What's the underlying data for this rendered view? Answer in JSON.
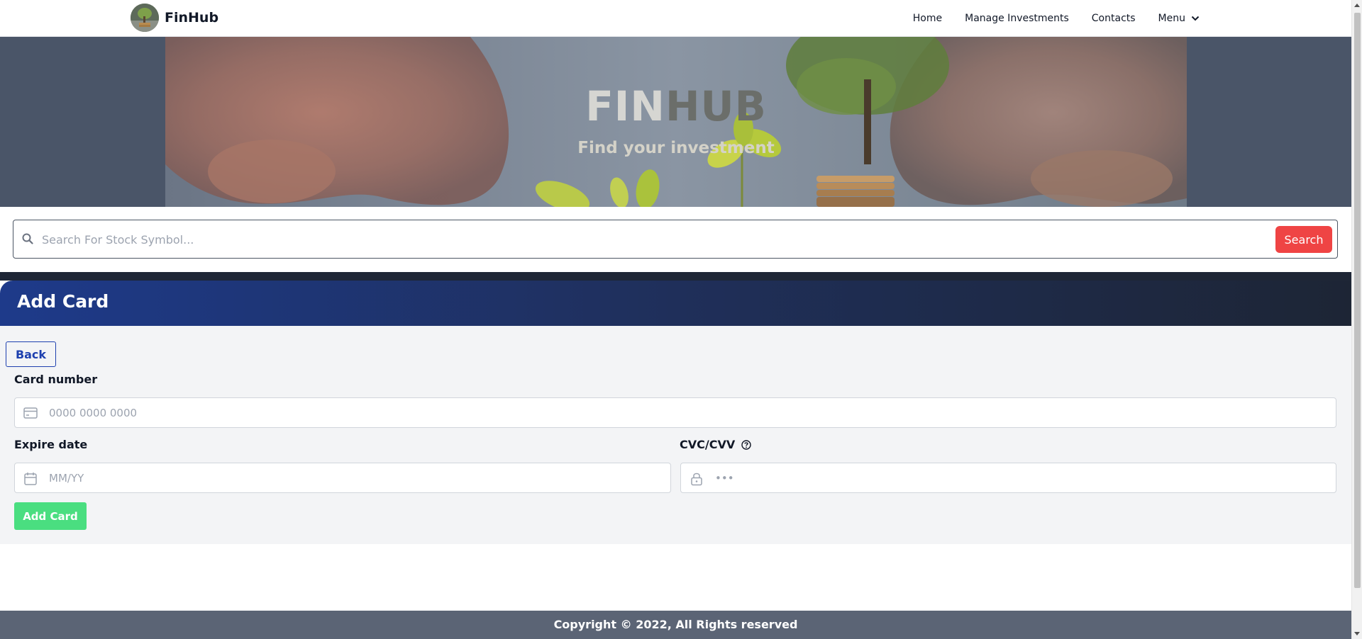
{
  "navbar": {
    "brand": "FinHub",
    "links": [
      {
        "label": "Home"
      },
      {
        "label": "Manage Investments"
      },
      {
        "label": "Contacts"
      },
      {
        "label": "Menu"
      }
    ]
  },
  "hero": {
    "title_part1": "FIN",
    "title_part2": "HUB",
    "subtitle": "Find your investment"
  },
  "search": {
    "placeholder": "Search For Stock Symbol...",
    "button_label": "Search"
  },
  "card_header": {
    "title": "Add Card"
  },
  "form": {
    "back_label": "Back",
    "card_number_label": "Card number",
    "card_number_placeholder": "0000 0000 0000",
    "expire_label": "Expire date",
    "expire_placeholder": "MM/YY",
    "cvc_label": "CVC/CVV",
    "cvc_placeholder": "•••",
    "submit_label": "Add Card"
  },
  "footer": {
    "text": "Copyright © 2022, All Rights reserved"
  },
  "icons": {
    "logo": "finhub-logo-icon",
    "chevron": "chevron-down-icon",
    "search": "search-icon",
    "card": "credit-card-icon",
    "calendar": "calendar-icon",
    "lock": "lock-icon",
    "help": "help-circle-icon"
  },
  "colors": {
    "accent_red": "#ef4444",
    "accent_green": "#4ade80",
    "header_blue": "#1e3a8a",
    "footer_gray": "#5b6475"
  }
}
